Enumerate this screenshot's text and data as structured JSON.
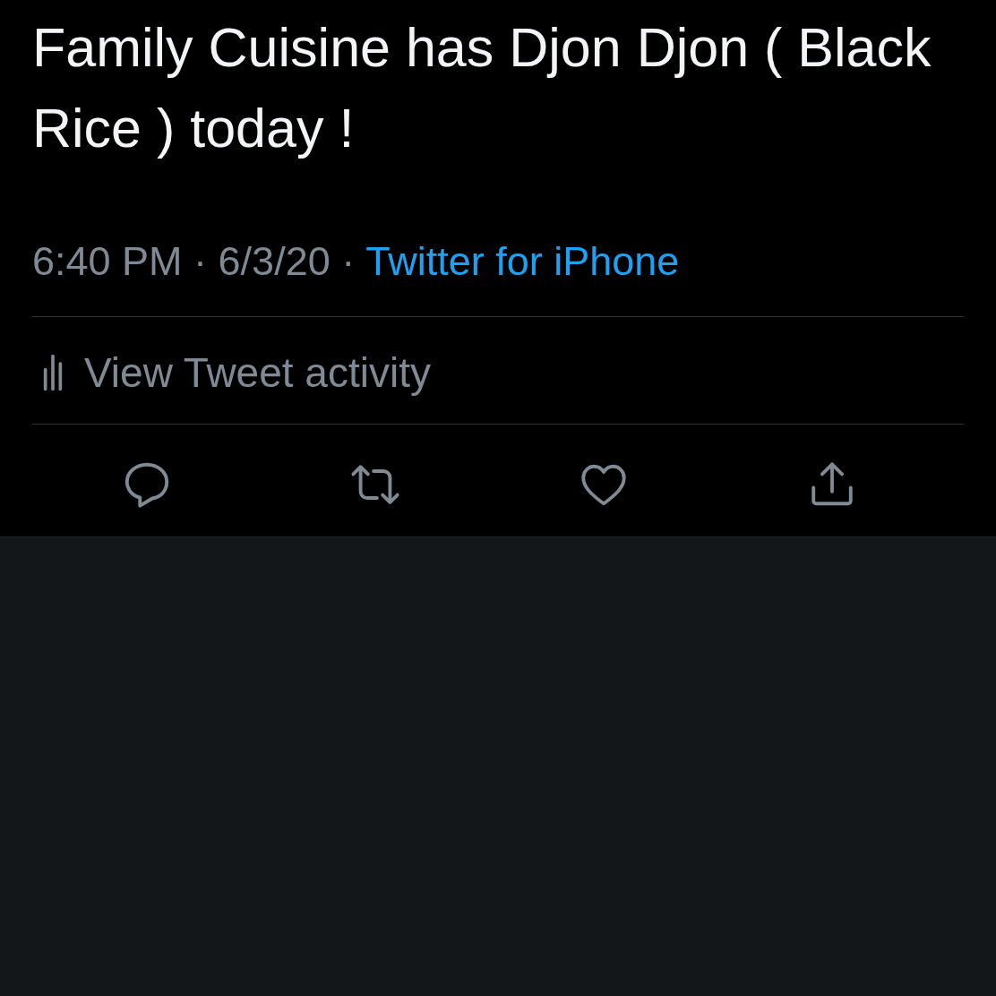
{
  "tweet": {
    "text": "Family Cuisine has Djon Djon ( Black Rice ) today !",
    "timestamp": "6:40 PM · 6/3/20 ·",
    "source": "Twitter for iPhone"
  },
  "activity": {
    "label": "View Tweet activity"
  },
  "actions": [
    {
      "kind": "reply"
    },
    {
      "kind": "retweet"
    },
    {
      "kind": "like"
    },
    {
      "kind": "share"
    }
  ]
}
